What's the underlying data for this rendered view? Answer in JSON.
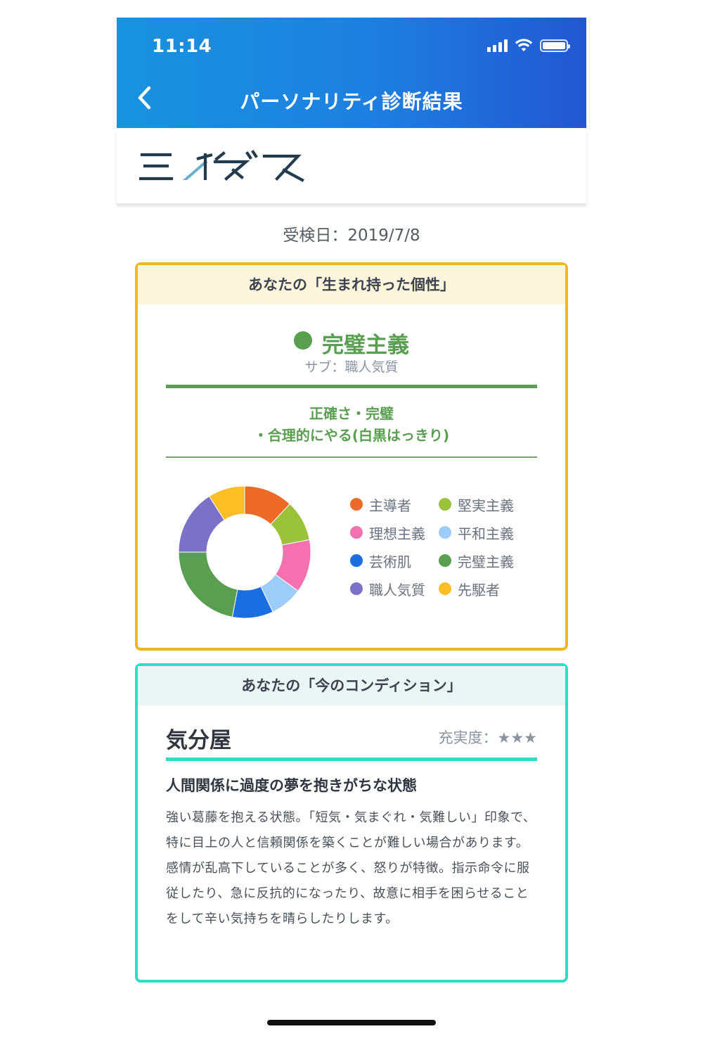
{
  "status_bar": {
    "time": "11:14"
  },
  "app_bar": {
    "title": "パーソナリティ診断結果"
  },
  "exam": {
    "date_text": "受検日：2019/7/8"
  },
  "innate": {
    "heading": "あなたの「生まれ持った個性」",
    "type_name": "完璧主義",
    "type_color": "#5a9e52",
    "sub_label": "サブ：職人気質",
    "description_line1": "正確さ・完璧",
    "description_line2": "・合理的にやる(白黒はっきり)"
  },
  "chart_data": {
    "type": "pie",
    "categories": [
      "主導者",
      "堅実主義",
      "理想主義",
      "平和主義",
      "芸術肌",
      "完璧主義",
      "職人気質",
      "先駆者"
    ],
    "values": [
      12,
      10,
      13,
      8,
      10,
      22,
      16,
      9
    ],
    "colors": [
      "#ef6a26",
      "#9ac33a",
      "#f470ae",
      "#9dcdf7",
      "#1b6ee0",
      "#5a9e52",
      "#7b72c8",
      "#fbbf25"
    ],
    "legend_order": [
      "主導者",
      "堅実主義",
      "理想主義",
      "平和主義",
      "芸術肌",
      "完璧主義",
      "職人気質",
      "先駆者"
    ],
    "legend_position": "right"
  },
  "condition": {
    "heading": "あなたの「今のコンディション」",
    "title": "気分屋",
    "rating_text": "充実度：★★★",
    "headline": "人間関係に過度の夢を抱きがちな状態",
    "body": "強い葛藤を抱える状態。「短気・気まぐれ・気難しい」印象で、 特に目上の人と信頼関係を築くことが難しい場合があります。感情が乱高下していることが多く、怒りが特徴。指示命令に服従したり、急に反抗的になったり、故意に相手を困らせることをして辛い気持ちを晴らしたりします。"
  }
}
